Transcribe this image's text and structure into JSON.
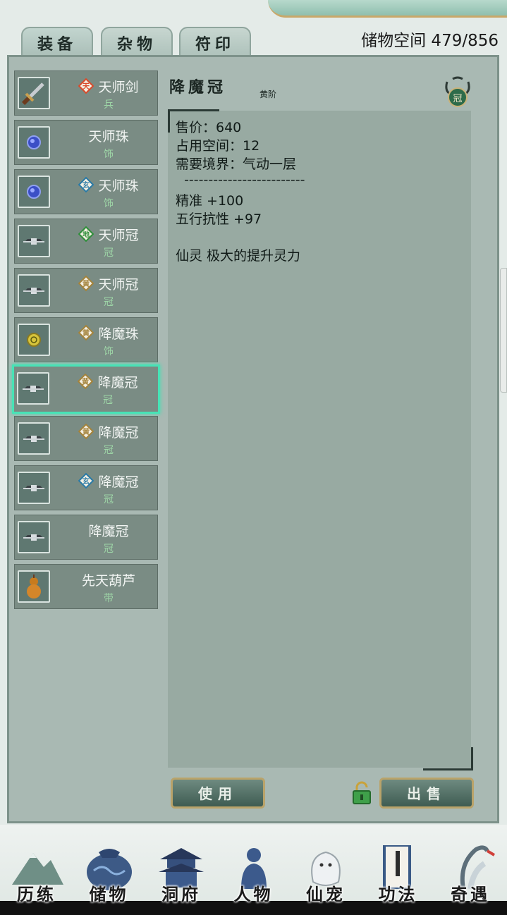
{
  "tabs": [
    {
      "label": "装备",
      "active": true
    },
    {
      "label": "杂物",
      "active": false
    },
    {
      "label": "符印",
      "active": false
    }
  ],
  "storage": {
    "label": "储物空间",
    "used": "479",
    "capacity": "856",
    "text": "储物空间 479/856"
  },
  "items": [
    {
      "name": "天师剑",
      "type": "兵",
      "badge": "天",
      "badge_color": "#d94a2a",
      "icon": "sword-icon"
    },
    {
      "name": "天师珠",
      "type": "饰",
      "badge": "",
      "badge_color": "",
      "icon": "blue-orb-icon"
    },
    {
      "name": "天师珠",
      "type": "饰",
      "badge": "玄",
      "badge_color": "#2a7aa6",
      "icon": "blue-orb-icon"
    },
    {
      "name": "天师冠",
      "type": "冠",
      "badge": "地",
      "badge_color": "#2f8f3a",
      "icon": "crown-icon"
    },
    {
      "name": "天师冠",
      "type": "冠",
      "badge": "黄",
      "badge_color": "#a4833b",
      "icon": "crown-icon"
    },
    {
      "name": "降魔珠",
      "type": "饰",
      "badge": "黄",
      "badge_color": "#a4833b",
      "icon": "yellow-orb-icon"
    },
    {
      "name": "降魔冠",
      "type": "冠",
      "badge": "黄",
      "badge_color": "#a4833b",
      "icon": "crown-icon",
      "selected": true
    },
    {
      "name": "降魔冠",
      "type": "冠",
      "badge": "黄",
      "badge_color": "#a4833b",
      "icon": "crown-icon"
    },
    {
      "name": "降魔冠",
      "type": "冠",
      "badge": "玄",
      "badge_color": "#2a7aa6",
      "icon": "crown-icon"
    },
    {
      "name": "降魔冠",
      "type": "冠",
      "badge": "",
      "badge_color": "",
      "icon": "crown-icon"
    },
    {
      "name": "先天葫芦",
      "type": "带",
      "badge": "",
      "badge_color": "",
      "icon": "gourd-icon"
    }
  ],
  "detail": {
    "name": "降魔冠",
    "grade": "黄阶",
    "slot_badge": "冠",
    "lines": [
      "售价：640",
      "占用空间：12",
      "需要境界：气动一层",
      "  -------------------------",
      "精准 +100",
      "五行抗性 +97",
      "",
      "仙灵 极大的提升灵力"
    ]
  },
  "buttons": {
    "use": "使用",
    "sell": "出售"
  },
  "nav": [
    {
      "label": "历练",
      "icon": "mountain-icon"
    },
    {
      "label": "储物",
      "icon": "bag-icon"
    },
    {
      "label": "洞府",
      "icon": "pagoda-icon"
    },
    {
      "label": "人物",
      "icon": "person-icon"
    },
    {
      "label": "仙宠",
      "icon": "pet-icon"
    },
    {
      "label": "功法",
      "icon": "book-icon"
    },
    {
      "label": "奇遇",
      "icon": "crane-icon"
    }
  ],
  "colors": {
    "selected_border": "#48e3b6",
    "item_bg": "#7a8c84",
    "type_text": "#9ed6a7"
  }
}
